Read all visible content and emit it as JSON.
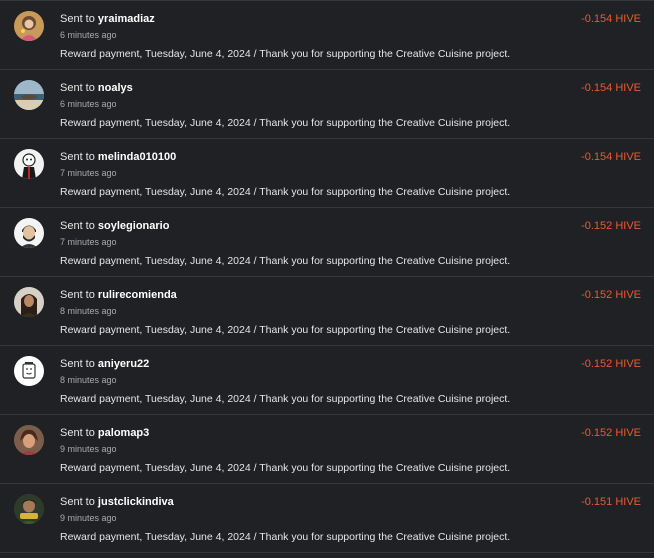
{
  "transfers": [
    {
      "prefix": "Sent to",
      "user": "yraimadiaz",
      "time": "6 minutes ago",
      "memo": "Reward payment, Tuesday, June 4, 2024 / Thank you for supporting the Creative Cuisine project.",
      "amount": "-0.154 HIVE"
    },
    {
      "prefix": "Sent to",
      "user": "noalys",
      "time": "6 minutes ago",
      "memo": "Reward payment, Tuesday, June 4, 2024 / Thank you for supporting the Creative Cuisine project.",
      "amount": "-0.154 HIVE"
    },
    {
      "prefix": "Sent to",
      "user": "melinda010100",
      "time": "7 minutes ago",
      "memo": "Reward payment, Tuesday, June 4, 2024 / Thank you for supporting the Creative Cuisine project.",
      "amount": "-0.154 HIVE"
    },
    {
      "prefix": "Sent to",
      "user": "soylegionario",
      "time": "7 minutes ago",
      "memo": "Reward payment, Tuesday, June 4, 2024 / Thank you for supporting the Creative Cuisine project.",
      "amount": "-0.152 HIVE"
    },
    {
      "prefix": "Sent to",
      "user": "rulirecomienda",
      "time": "8 minutes ago",
      "memo": "Reward payment, Tuesday, June 4, 2024 / Thank you for supporting the Creative Cuisine project.",
      "amount": "-0.152 HIVE"
    },
    {
      "prefix": "Sent to",
      "user": "aniyeru22",
      "time": "8 minutes ago",
      "memo": "Reward payment, Tuesday, June 4, 2024 / Thank you for supporting the Creative Cuisine project.",
      "amount": "-0.152 HIVE"
    },
    {
      "prefix": "Sent to",
      "user": "palomap3",
      "time": "9 minutes ago",
      "memo": "Reward payment, Tuesday, June 4, 2024 / Thank you for supporting the Creative Cuisine project.",
      "amount": "-0.152 HIVE"
    },
    {
      "prefix": "Sent to",
      "user": "justclickindiva",
      "time": "9 minutes ago",
      "memo": "Reward payment, Tuesday, June 4, 2024 / Thank you for supporting the Creative Cuisine project.",
      "amount": "-0.151 HIVE"
    }
  ],
  "colors": {
    "background": "#1f2124",
    "divider": "#34373b",
    "amount": "#ea5a36",
    "muted": "#a9abaf"
  }
}
